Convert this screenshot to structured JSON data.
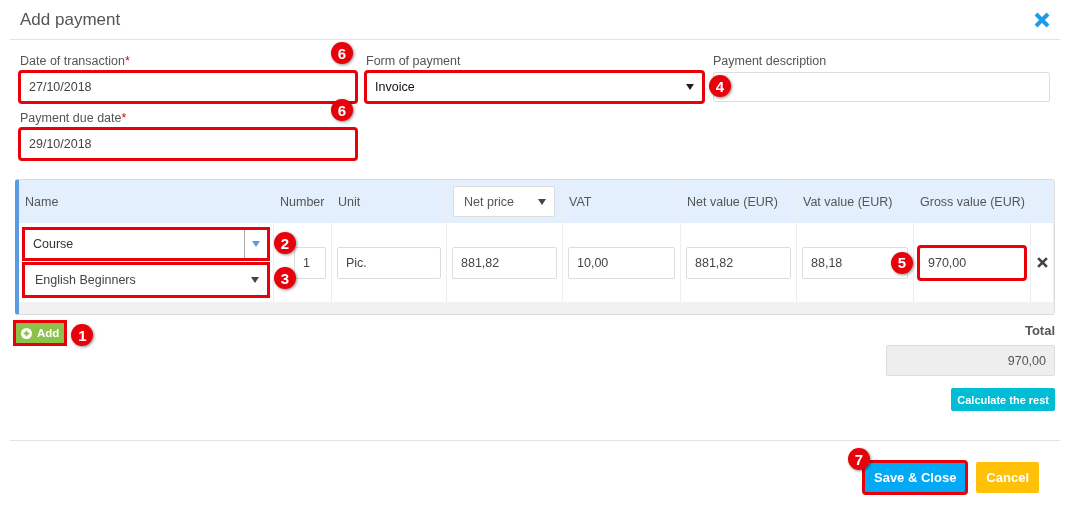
{
  "dialog": {
    "title": "Add payment"
  },
  "fields": [
    {
      "label": "Date of transaction",
      "required_mark": "*",
      "kind": "text",
      "value": "27/10/2018",
      "highlighted": true,
      "callout": "6"
    },
    {
      "label": "Form of payment",
      "kind": "select",
      "value": "Invoice",
      "highlighted": true,
      "callout": "4"
    },
    {
      "label": "Payment description",
      "kind": "text",
      "highlighted": false
    },
    {
      "label": "Payment due date",
      "required_mark": "*",
      "kind": "text",
      "value": "29/10/2018",
      "highlighted": true,
      "callout": "6"
    }
  ],
  "table": {
    "columns": [
      {
        "label": "Name",
        "kind": "text"
      },
      {
        "label": "Number",
        "kind": "text"
      },
      {
        "label": "Unit",
        "kind": "text"
      },
      {
        "label": "Net price",
        "kind": "select"
      },
      {
        "label": "VAT",
        "kind": "text"
      },
      {
        "label": "Net value (EUR)",
        "kind": "text"
      },
      {
        "label": "Vat value (EUR)",
        "kind": "text"
      },
      {
        "label": "Gross value (EUR)",
        "kind": "text"
      }
    ],
    "rows": [
      {
        "cells": [
          {
            "kind": "name",
            "name_fields": [
              {
                "kind": "combo",
                "value": "Course",
                "highlighted": true,
                "callout": "2"
              },
              {
                "kind": "select",
                "value": "English Beginners",
                "highlighted": true,
                "callout": "3"
              }
            ]
          },
          {
            "value": "1",
            "highlighted": false
          },
          {
            "value": "Pic.",
            "highlighted": false
          },
          {
            "value": "881,82",
            "highlighted": false
          },
          {
            "value": "10,00",
            "highlighted": false
          },
          {
            "value": "881,82",
            "highlighted": false
          },
          {
            "value": "88,18",
            "highlighted": false
          },
          {
            "value": "970,00",
            "highlighted": true,
            "callout": "5"
          }
        ]
      }
    ]
  },
  "add_button": {
    "label": "Add",
    "highlighted": true,
    "callout": "1"
  },
  "total": {
    "label": "Total",
    "value": "970,00"
  },
  "calculate_button": {
    "label": "Calculate the rest"
  },
  "footer_buttons": [
    {
      "label": "Save & Close",
      "kind": "primary",
      "highlighted": true,
      "callout": "7"
    },
    {
      "label": "Cancel",
      "kind": "warning",
      "highlighted": false
    }
  ]
}
